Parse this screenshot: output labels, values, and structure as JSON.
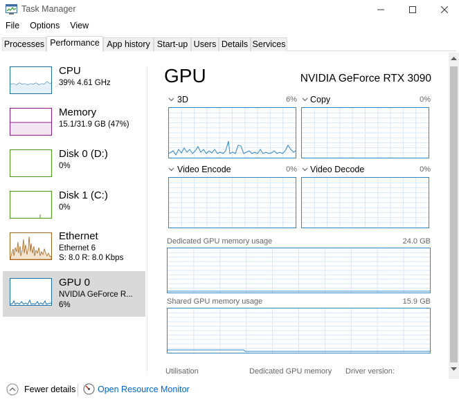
{
  "window": {
    "title": "Task Manager"
  },
  "menu": [
    "File",
    "Options",
    "View"
  ],
  "tabs": [
    "Processes",
    "Performance",
    "App history",
    "Start-up",
    "Users",
    "Details",
    "Services"
  ],
  "active_tab": "Performance",
  "resources": [
    {
      "name": "CPU",
      "sub1": "39% 4.61 GHz",
      "sub2": "",
      "color": "#1a6fb0"
    },
    {
      "name": "Memory",
      "sub1": "15.1/31.9 GB (47%)",
      "sub2": "",
      "color": "#8b1a8b"
    },
    {
      "name": "Disk 0 (D:)",
      "sub1": "0%",
      "sub2": "",
      "color": "#4a9a1a"
    },
    {
      "name": "Disk 1 (C:)",
      "sub1": "0%",
      "sub2": "",
      "color": "#4a9a1a"
    },
    {
      "name": "Ethernet",
      "sub1": "Ethernet 6",
      "sub2": "S: 8.0  R: 8.0 Kbps",
      "color": "#a8641a"
    },
    {
      "name": "GPU 0",
      "sub1": "NVIDIA GeForce R...",
      "sub2": "6%",
      "color": "#1a6fb0"
    }
  ],
  "detail": {
    "title": "GPU",
    "model": "NVIDIA GeForce RTX 3090",
    "engines": [
      {
        "label": "3D",
        "percent": "6%"
      },
      {
        "label": "Copy",
        "percent": "0%"
      },
      {
        "label": "Video Encode",
        "percent": "0%"
      },
      {
        "label": "Video Decode",
        "percent": "0%"
      }
    ],
    "dedicated": {
      "label": "Dedicated GPU memory usage",
      "max": "24.0 GB"
    },
    "shared": {
      "label": "Shared GPU memory usage",
      "max": "15.9 GB"
    },
    "bottom_labels": [
      "Utilisation",
      "Dedicated GPU memory",
      "Driver version:"
    ]
  },
  "footer": {
    "fewer_details": "Fewer details",
    "resource_monitor": "Open Resource Monitor"
  },
  "colors": {
    "gpu_line": "#2f86c8",
    "grid": "#d9e8f5",
    "selected_bg": "#d9d9d9",
    "link": "#0066cc"
  }
}
